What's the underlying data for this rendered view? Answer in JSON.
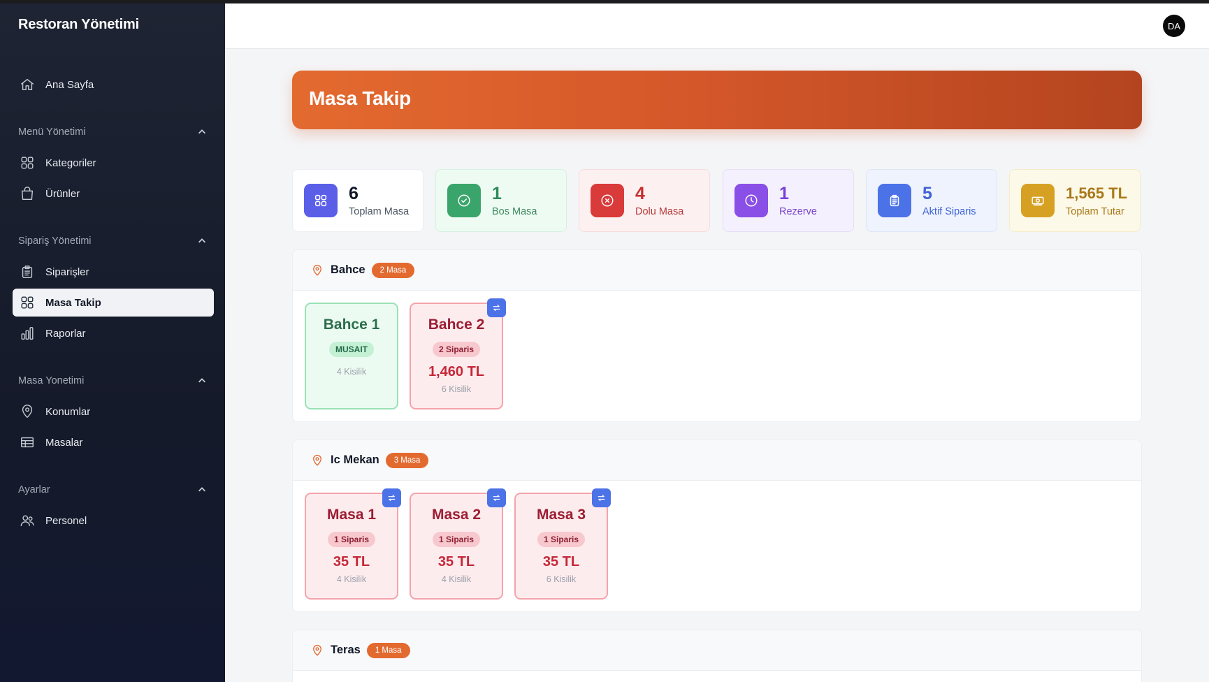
{
  "app": {
    "title": "Restoran Yönetimi"
  },
  "sidebar": {
    "home": {
      "label": "Ana Sayfa"
    },
    "sections": [
      {
        "title": "Menü Yönetimi",
        "items": [
          {
            "label": "Kategoriler"
          },
          {
            "label": "Ürünler"
          }
        ]
      },
      {
        "title": "Sipariş Yönetimi",
        "items": [
          {
            "label": "Siparişler"
          },
          {
            "label": "Masa Takip"
          },
          {
            "label": "Raporlar"
          }
        ]
      },
      {
        "title": "Masa Yonetimi",
        "items": [
          {
            "label": "Konumlar"
          },
          {
            "label": "Masalar"
          }
        ]
      },
      {
        "title": "Ayarlar",
        "items": [
          {
            "label": "Personel"
          }
        ]
      }
    ],
    "active": "Masa Takip"
  },
  "header": {
    "avatar_initials": "DA"
  },
  "page": {
    "title": "Masa Takip"
  },
  "stats": [
    {
      "value": "6",
      "label": "Toplam Masa",
      "icon": "grid-icon",
      "color": "#5b5fe8"
    },
    {
      "value": "1",
      "label": "Bos Masa",
      "icon": "check-circle-icon",
      "color": "#3aa56b"
    },
    {
      "value": "4",
      "label": "Dolu Masa",
      "icon": "x-circle-icon",
      "color": "#d93a3a"
    },
    {
      "value": "1",
      "label": "Rezerve",
      "icon": "clock-icon",
      "color": "#8a4fe6"
    },
    {
      "value": "5",
      "label": "Aktif Siparis",
      "icon": "clipboard-icon",
      "color": "#4c72e8"
    },
    {
      "value": "1,565 TL",
      "label": "Toplam Tutar",
      "icon": "money-icon",
      "color": "#d6a123"
    }
  ],
  "locations": [
    {
      "name": "Bahce",
      "badge": "2 Masa",
      "tables": [
        {
          "name": "Bahce 1",
          "status": "MUSAIT",
          "amount": "",
          "capacity": "4 Kisilik"
        },
        {
          "name": "Bahce 2",
          "status": "2 Siparis",
          "amount": "1,460 TL",
          "capacity": "6 Kisilik"
        }
      ]
    },
    {
      "name": "Ic Mekan",
      "badge": "3 Masa",
      "tables": [
        {
          "name": "Masa 1",
          "status": "1 Siparis",
          "amount": "35 TL",
          "capacity": "4 Kisilik"
        },
        {
          "name": "Masa 2",
          "status": "1 Siparis",
          "amount": "35 TL",
          "capacity": "4 Kisilik"
        },
        {
          "name": "Masa 3",
          "status": "1 Siparis",
          "amount": "35 TL",
          "capacity": "6 Kisilik"
        }
      ]
    },
    {
      "name": "Teras",
      "badge": "1 Masa",
      "tables": []
    }
  ]
}
